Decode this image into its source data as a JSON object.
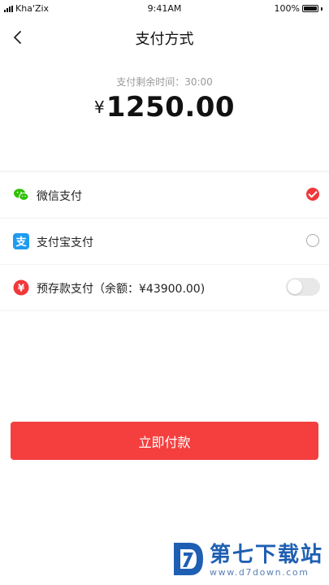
{
  "status_bar": {
    "carrier": "Kha'Zix",
    "time": "9:41AM",
    "battery": "100%"
  },
  "nav": {
    "back_icon": "chevron-left-icon",
    "title": "支付方式"
  },
  "payment": {
    "timer_text": "支付剩余时间：30:00",
    "currency": "¥",
    "amount": "1250.00"
  },
  "methods": [
    {
      "label": "微信支付",
      "icon": "wechat-icon",
      "icon_color": "#2dc100",
      "selected": true
    },
    {
      "label": "支付宝支付",
      "icon": "alipay-icon",
      "icon_color": "#1e9bf0",
      "selected": false
    },
    {
      "label": "预存款支付（余额：¥43900.00)",
      "icon": "deposit-icon",
      "icon_color": "#f0383b",
      "toggle_on": false
    }
  ],
  "pay_button": {
    "label": "立即付款",
    "color": "#f53f3f"
  },
  "watermark": {
    "title": "第七下载站",
    "url": "www.d7down.com"
  },
  "colors": {
    "accent": "#f0383b",
    "primary_button": "#f53f3f",
    "watermark": "#1f5fb3"
  }
}
